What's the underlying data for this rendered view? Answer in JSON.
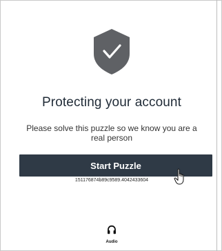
{
  "page": {
    "title": "Protecting your account",
    "subtitle": "Please solve this puzzle so we know you are a real person",
    "start_button_label": "Start Puzzle",
    "session_id": "151176874b89c9589.4042433604",
    "audio_label": "Audio"
  },
  "icons": {
    "shield": "shield-check-icon",
    "audio": "headphones-icon",
    "cursor": "hand-pointer-cursor"
  },
  "colors": {
    "shield_fill": "#5f6165",
    "button_bg": "#2f3a46",
    "button_text": "#ffffff",
    "title_text": "#1f2a36"
  }
}
